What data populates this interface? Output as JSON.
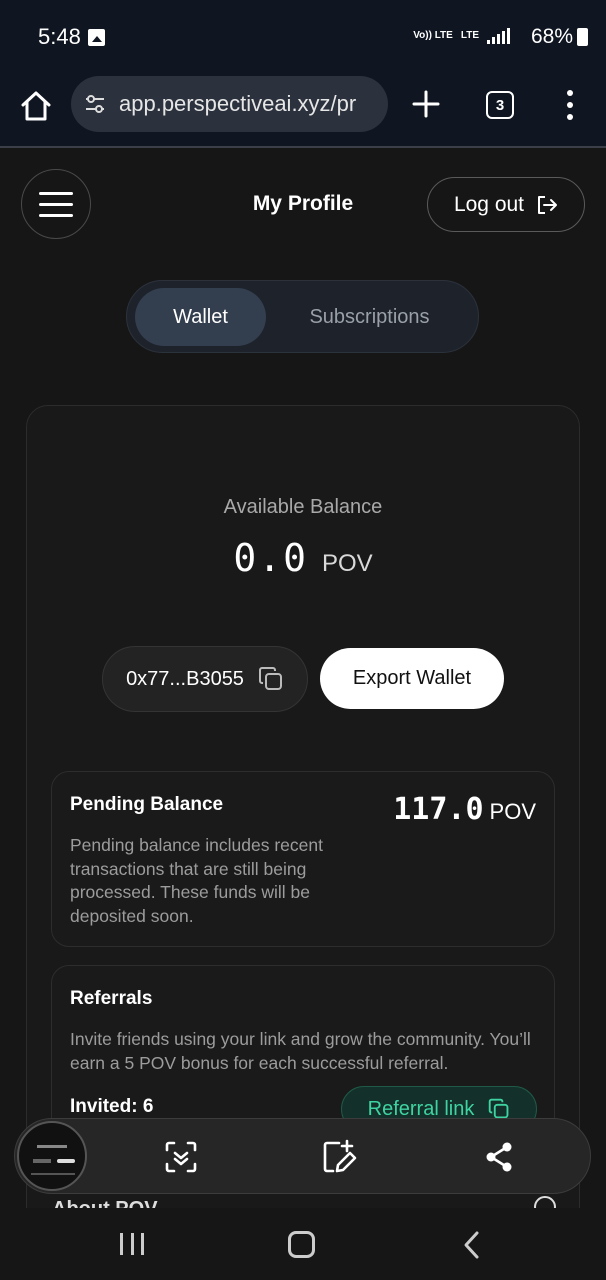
{
  "status_bar": {
    "time": "5:48",
    "network_top": "Vo)) LTE",
    "network_bottom": "LTE",
    "battery": "68%",
    "icons": [
      "image-icon",
      "signal-icon",
      "battery-icon"
    ]
  },
  "browser": {
    "url": "app.perspectiveai.xyz/pr",
    "tab_count": "3",
    "icons": [
      "home-icon",
      "tune-icon",
      "plus-icon",
      "tabs-icon",
      "more-icon"
    ]
  },
  "header": {
    "title": "My Profile",
    "logout_label": "Log out"
  },
  "tabs": [
    {
      "label": "Wallet",
      "active": true
    },
    {
      "label": "Subscriptions",
      "active": false
    }
  ],
  "wallet": {
    "available_label": "Available Balance",
    "balance": "0.0",
    "unit": "POV",
    "address": "0x77...B3055",
    "export_label": "Export Wallet"
  },
  "pending": {
    "title": "Pending Balance",
    "amount": "117.0",
    "unit": "POV",
    "description": "Pending balance includes recent transactions that are still being processed. These funds will be deposited soon."
  },
  "referrals": {
    "title": "Referrals",
    "description": "Invite friends using your link and grow the community. You’ll earn a 5 POV bonus for each successful referral.",
    "invited": "Invited: 6",
    "link_label": "Referral link"
  },
  "about_peek": "About POV",
  "colors": {
    "background": "#161616",
    "accent_green": "#3ed3a0",
    "active_tab": "#333e4f"
  }
}
